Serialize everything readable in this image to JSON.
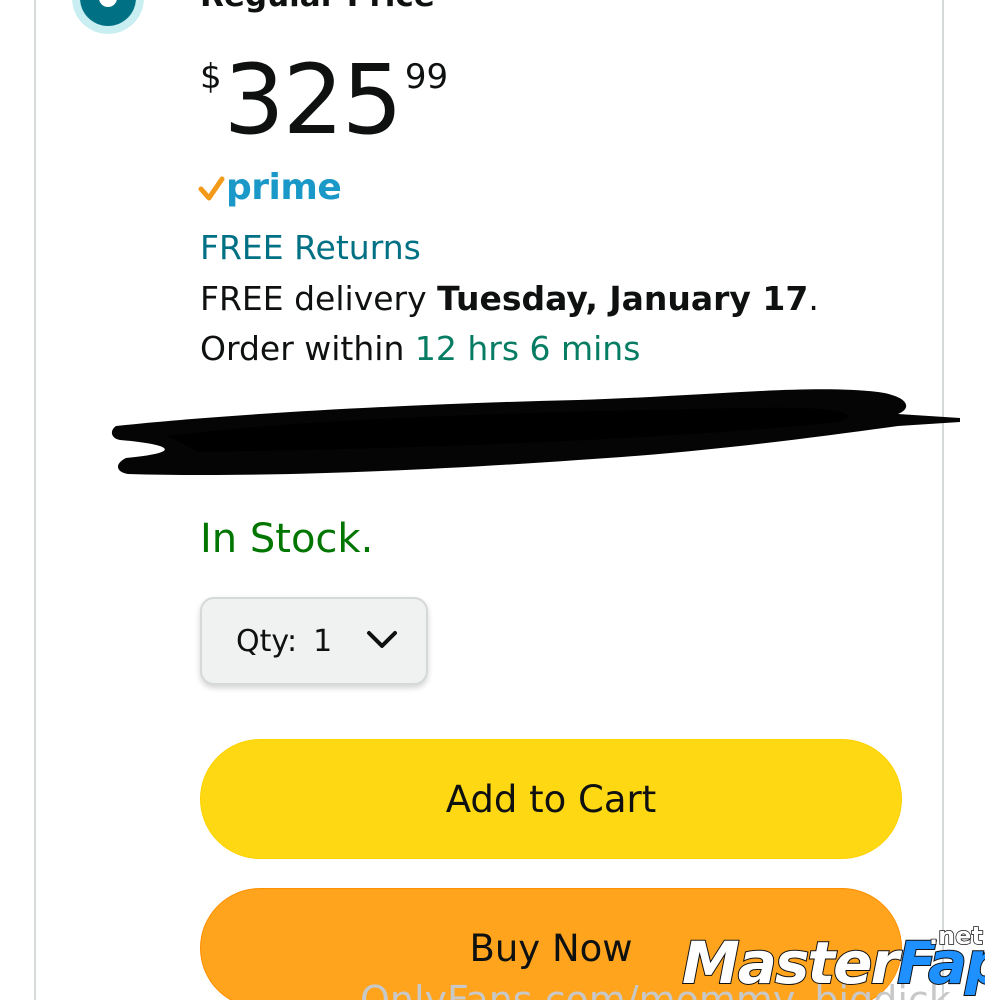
{
  "option": {
    "label": "Regular Price",
    "selected": true
  },
  "price": {
    "symbol": "$",
    "whole": "325",
    "fraction": "99"
  },
  "badges": {
    "prime": "prime",
    "free_returns": "FREE Returns"
  },
  "delivery": {
    "prefix": "FREE delivery ",
    "date": "Tuesday, January 17",
    "suffix": "."
  },
  "order_within": {
    "prefix": "Order within ",
    "countdown": "12 hrs 6 mins"
  },
  "stock_status": "In Stock.",
  "quantity": {
    "label": "Qty:",
    "value": "1"
  },
  "buttons": {
    "add_to_cart": "Add to Cart",
    "buy_now": "Buy Now"
  },
  "overlay_text": "OnlyFans.com/mommy_bigdick",
  "watermark": {
    "main": "Master",
    "accent": "Fap",
    "tld": ".net"
  },
  "colors": {
    "link_teal": "#007185",
    "success_green": "#007600",
    "countdown_green": "#067d62",
    "prime_blue": "#1a98c7",
    "prime_check_orange": "#f49a1a",
    "add_to_cart_yellow": "#ffd814",
    "buy_now_orange": "#ffa41c",
    "text_dark": "#0f1111"
  },
  "icons": {
    "radio": "radio-selected-icon",
    "prime_check": "check-icon",
    "qty_dropdown": "chevron-down-icon"
  }
}
